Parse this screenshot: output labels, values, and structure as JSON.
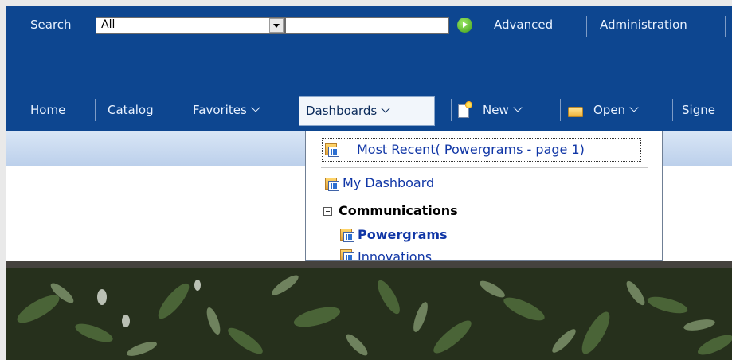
{
  "search": {
    "label": "Search",
    "scope_value": "All",
    "query_value": "",
    "advanced": "Advanced",
    "administration": "Administration"
  },
  "nav": {
    "home": "Home",
    "catalog": "Catalog",
    "favorites": "Favorites",
    "dashboards": "Dashboards",
    "new": "New",
    "open": "Open",
    "signed_in": "Signe"
  },
  "dashboards_menu": {
    "most_recent": "Most Recent( Powergrams - page 1)",
    "my_dashboard": "My Dashboard",
    "group": "Communications",
    "items": [
      "Powergrams",
      "Innovations"
    ]
  },
  "colors": {
    "nav_background": "#0d4690",
    "link": "#1036a6"
  }
}
